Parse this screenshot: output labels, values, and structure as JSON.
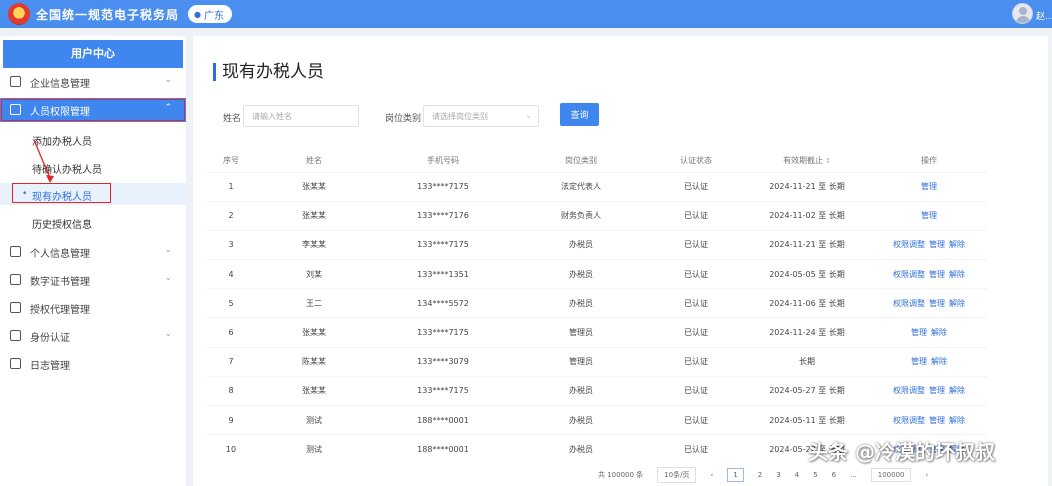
{
  "header": {
    "title": "全国统一规范电子税务局",
    "region": "广东",
    "user_name": "赵..."
  },
  "sidebar": {
    "heading": "用户中心",
    "items": [
      {
        "label": "企业信息管理",
        "icon": "building-icon"
      },
      {
        "label": "人员权限管理",
        "icon": "lock-icon",
        "active": true
      },
      {
        "label": "个人信息管理",
        "icon": "id-card-icon"
      },
      {
        "label": "数字证书管理",
        "icon": "certificate-icon"
      },
      {
        "label": "授权代理管理",
        "icon": "delegate-icon"
      },
      {
        "label": "身份认证",
        "icon": "fingerprint-icon"
      },
      {
        "label": "日志管理",
        "icon": "log-icon"
      }
    ],
    "sub_items": [
      {
        "label": "添加办税人员"
      },
      {
        "label": "待确认办税人员"
      },
      {
        "label": "现有办税人员",
        "current": true
      },
      {
        "label": "历史授权信息"
      }
    ]
  },
  "main": {
    "title": "现有办税人员",
    "filters": {
      "name_label": "姓名",
      "name_placeholder": "请输入姓名",
      "identity_label": "岗位类别",
      "identity_placeholder": "请选择岗位类别",
      "query_button": "查询"
    },
    "table": {
      "headers": [
        "序号",
        "姓名",
        "手机号码",
        "岗位类别",
        "认证状态",
        "有效期截止",
        "操作"
      ],
      "rows": [
        {
          "no": "1",
          "name": "张某某",
          "phone": "133****7175",
          "role": "法定代表人",
          "status": "已认证",
          "expiry": "2024-11-21 至 长期",
          "ops": [
            "管理"
          ]
        },
        {
          "no": "2",
          "name": "张某某",
          "phone": "133****7176",
          "role": "财务负责人",
          "status": "已认证",
          "expiry": "2024-11-02 至 长期",
          "ops": [
            "管理"
          ]
        },
        {
          "no": "3",
          "name": "李某某",
          "phone": "133****7175",
          "role": "办税员",
          "status": "已认证",
          "expiry": "2024-11-21 至 长期",
          "ops": [
            "权限调整",
            "管理",
            "解除"
          ]
        },
        {
          "no": "4",
          "name": "刘某",
          "phone": "133****1351",
          "role": "办税员",
          "status": "已认证",
          "expiry": "2024-05-05 至 长期",
          "ops": [
            "权限调整",
            "管理",
            "解除"
          ]
        },
        {
          "no": "5",
          "name": "王二",
          "phone": "134****5572",
          "role": "办税员",
          "status": "已认证",
          "expiry": "2024-11-06 至 长期",
          "ops": [
            "权限调整",
            "管理",
            "解除"
          ]
        },
        {
          "no": "6",
          "name": "张某某",
          "phone": "133****7175",
          "role": "管理员",
          "status": "已认证",
          "expiry": "2024-11-24 至 长期",
          "ops": [
            "管理",
            "解除"
          ]
        },
        {
          "no": "7",
          "name": "陈某某",
          "phone": "133****3079",
          "role": "管理员",
          "status": "已认证",
          "expiry": "长期",
          "ops": [
            "管理",
            "解除"
          ]
        },
        {
          "no": "8",
          "name": "张某某",
          "phone": "133****7175",
          "role": "办税员",
          "status": "已认证",
          "expiry": "2024-05-27 至 长期",
          "ops": [
            "权限调整",
            "管理",
            "解除"
          ]
        },
        {
          "no": "9",
          "name": "测试",
          "phone": "188****0001",
          "role": "办税员",
          "status": "已认证",
          "expiry": "2024-05-11 至 长期",
          "ops": [
            "权限调整",
            "管理",
            "解除"
          ]
        },
        {
          "no": "10",
          "name": "测试",
          "phone": "188****0001",
          "role": "办税员",
          "status": "已认证",
          "expiry": "2024-05-22 至 长期",
          "ops": [
            "权限调整",
            "管理",
            "解除"
          ]
        }
      ]
    },
    "pagination": {
      "total": "共 100000 条",
      "page_size": "10条/页",
      "pages": [
        "1",
        "2",
        "3",
        "4",
        "5",
        "6",
        "..."
      ],
      "current": "1",
      "jump_value": "100000"
    }
  },
  "annotation": {
    "highlight_color": "#e0262c"
  },
  "watermark": "头条 @冷漠的坏叔叔",
  "colors": {
    "topbar": "#4a8ef0",
    "accent": "#3f86ee",
    "link": "#2f6fd8",
    "background": "#eef1f5"
  }
}
